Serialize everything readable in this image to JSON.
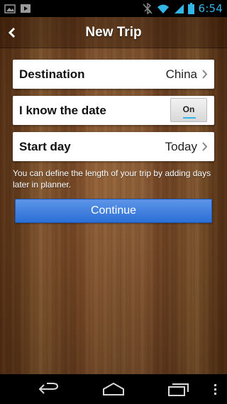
{
  "status_bar": {
    "time": "6:54",
    "icons": [
      "image-notification-icon",
      "media-notification-icon",
      "bluetooth-off-icon",
      "wifi-icon",
      "signal-icon",
      "battery-icon"
    ]
  },
  "header": {
    "title": "New Trip",
    "back_icon": "chevron-left-icon"
  },
  "form": {
    "destination": {
      "label": "Destination",
      "value": "China"
    },
    "know_date": {
      "label": "I know the date",
      "toggle_text": "On"
    },
    "start_day": {
      "label": "Start day",
      "value": "Today"
    },
    "hint": "You can define the length of your trip by adding days later in planner.",
    "continue_label": "Continue"
  },
  "nav_bar": {
    "buttons": [
      "back-nav-icon",
      "home-nav-icon",
      "recents-nav-icon",
      "overflow-menu-icon"
    ]
  },
  "colors": {
    "accent": "#33b5e5",
    "button_blue": "#2c6fd6",
    "wood": "#7a4a22"
  }
}
